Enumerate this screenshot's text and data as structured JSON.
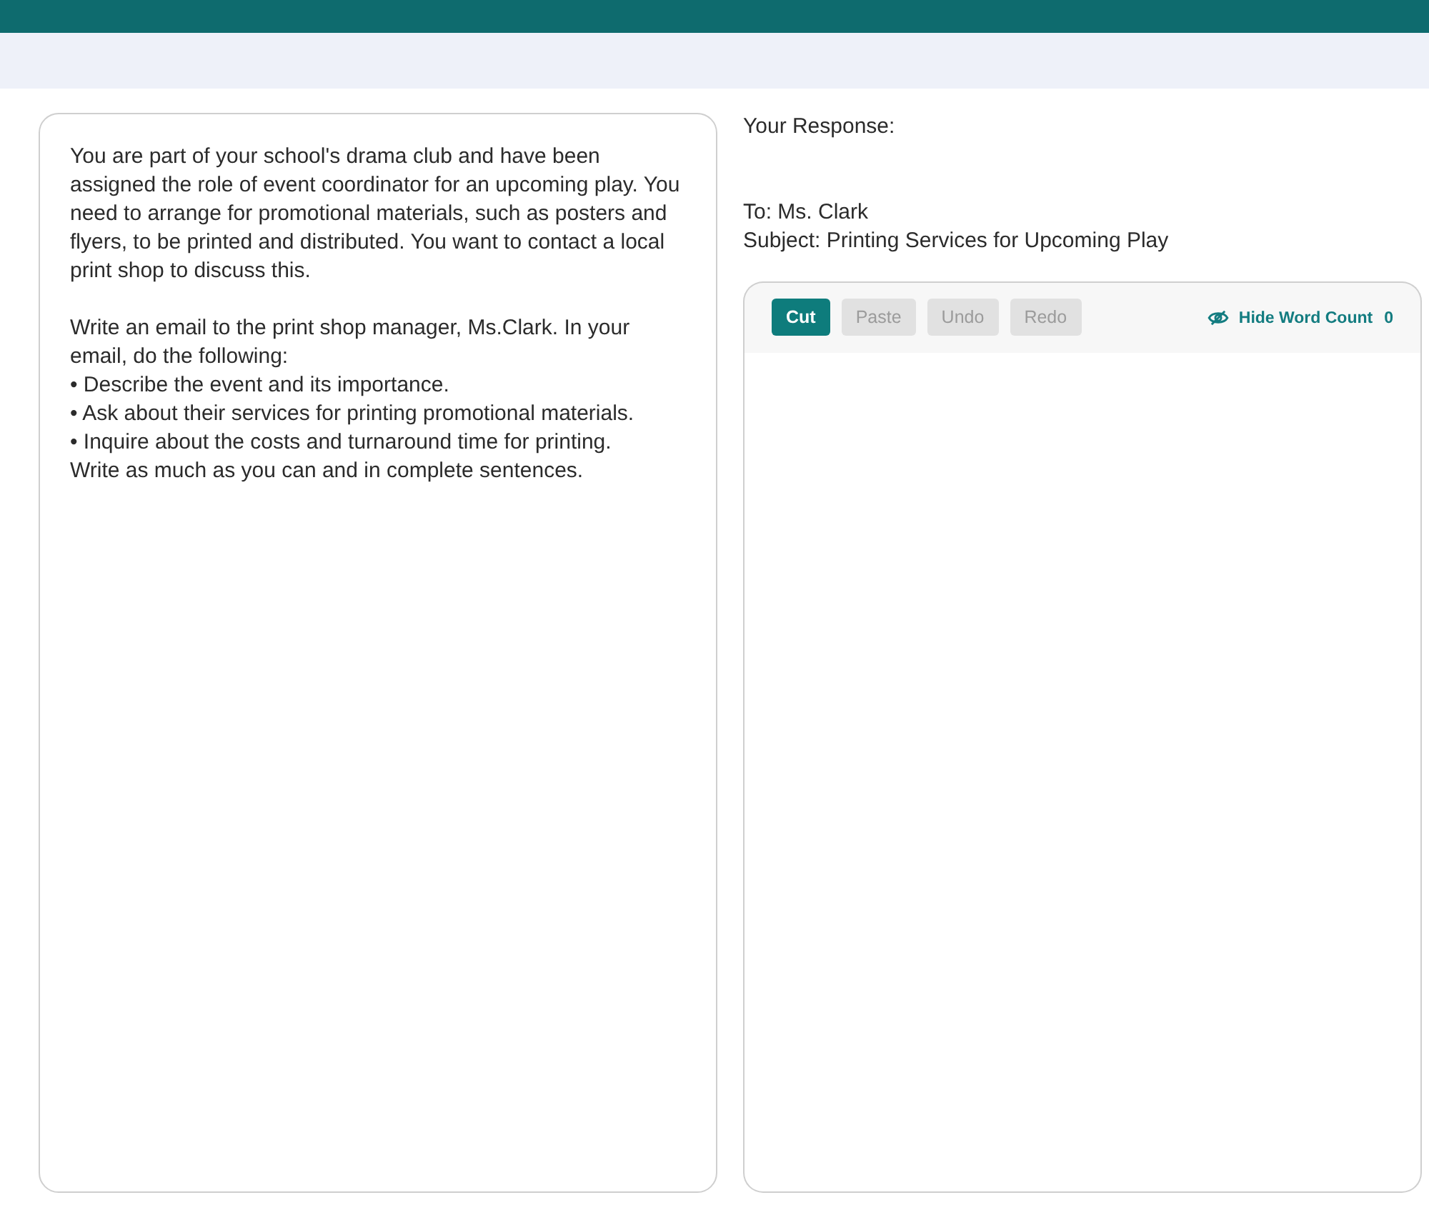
{
  "prompt": {
    "paragraphs": [
      "You are part of your school's drama club and have been assigned the role of event coordinator for an upcoming play. You need to arrange for promotional materials, such as posters and flyers, to be printed and distributed. You want to contact a local print shop to discuss this."
    ],
    "instructions": {
      "intro": "Write an email to the print shop manager, Ms.Clark. In your email, do the following:",
      "bullets": [
        "• Describe the event and its importance.",
        "• Ask about their services for printing promotional materials.",
        "• Inquire about the costs and turnaround time for printing."
      ],
      "closing": "Write as much as you can and in complete sentences."
    }
  },
  "response": {
    "label": "Your Response:",
    "to": "To: Ms. Clark",
    "subject": "Subject: Printing Services for Upcoming Play",
    "toolbar": {
      "buttons": [
        {
          "label": "Cut",
          "disabled": false
        },
        {
          "label": "Paste",
          "disabled": true
        },
        {
          "label": "Undo",
          "disabled": true
        },
        {
          "label": "Redo",
          "disabled": true
        }
      ],
      "word_count_toggle": "Hide Word Count",
      "word_count": "0"
    }
  }
}
